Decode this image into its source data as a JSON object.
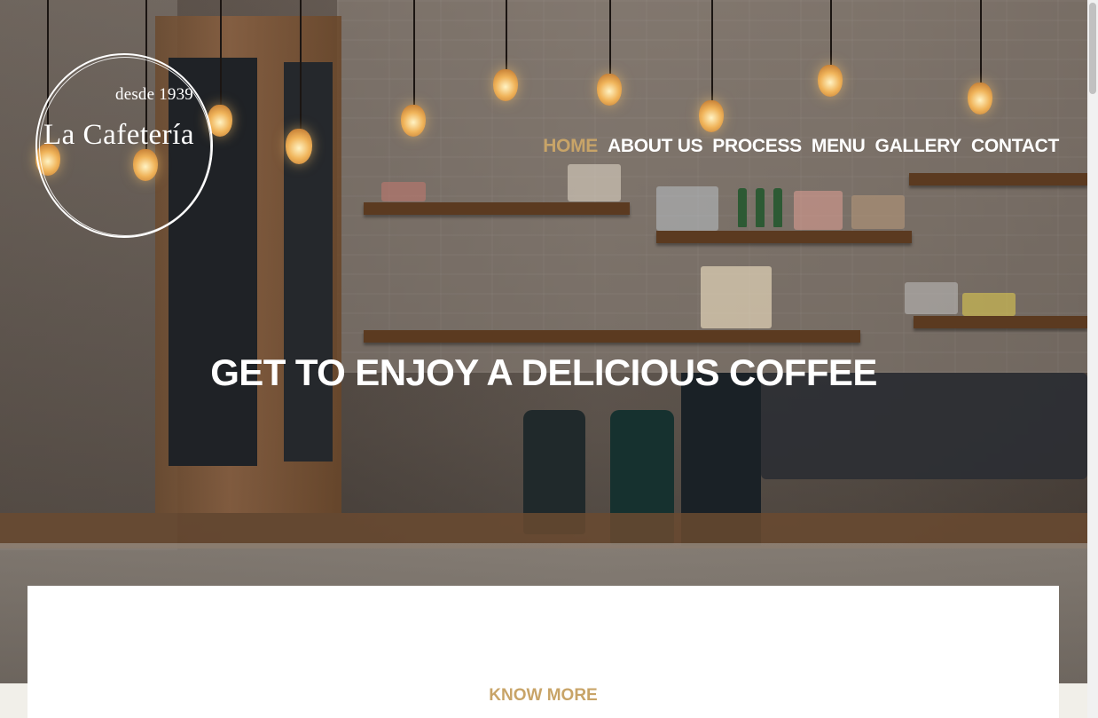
{
  "brand": {
    "since": "desde 1939",
    "name": "La Cafetería"
  },
  "nav": {
    "items": [
      {
        "label": "HOME",
        "active": true
      },
      {
        "label": "ABOUT US",
        "active": false
      },
      {
        "label": "PROCESS",
        "active": false
      },
      {
        "label": "MENU",
        "active": false
      },
      {
        "label": "GALLERY",
        "active": false
      },
      {
        "label": "CONTACT",
        "active": false
      }
    ]
  },
  "hero": {
    "headline": "GET TO ENJOY A DELICIOUS COFFEE",
    "background_image": "cafe-interior-photo"
  },
  "intro": {
    "cta_label": "KNOW MORE"
  },
  "colors": {
    "accent": "#c8a468",
    "nav_text": "#ffffff",
    "panel_bg": "#ffffff"
  }
}
